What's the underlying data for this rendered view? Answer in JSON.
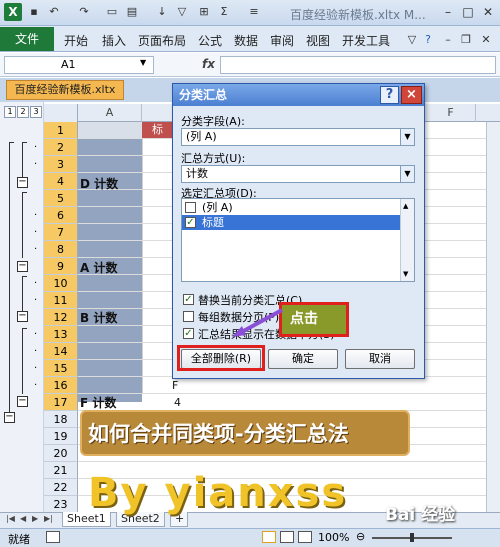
{
  "window": {
    "title": "百度经验新模板.xltx M..."
  },
  "ribbon": {
    "file": "文件",
    "tabs": [
      "开始",
      "插入",
      "页面布局",
      "公式",
      "数据",
      "审阅",
      "视图",
      "开发工具"
    ]
  },
  "formula_bar": {
    "name_box": "A1",
    "fx": "fx",
    "content": ""
  },
  "workbook_tab": "百度经验新模板.xltx",
  "outline_levels": [
    "1",
    "2",
    "3"
  ],
  "columns": [
    "A",
    "F"
  ],
  "rows": [
    "1",
    "2",
    "3",
    "4",
    "5",
    "6",
    "7",
    "8",
    "9",
    "10",
    "11",
    "12",
    "13",
    "14",
    "15",
    "16",
    "17",
    "18",
    "19",
    "20",
    "21",
    "22",
    "23"
  ],
  "sheet": {
    "b1_header": "标",
    "groups": [
      {
        "label": "D 计数"
      },
      {
        "label": "A 计数"
      },
      {
        "label": "B 计数"
      },
      {
        "label": "F 计数",
        "value": "4"
      }
    ],
    "b16_value": "F"
  },
  "sheet_tabs": [
    "Sheet1",
    "Sheet2"
  ],
  "status": {
    "left": "就绪",
    "zoom": "100%"
  },
  "dialog": {
    "title": "分类汇总",
    "help": "?",
    "close": "×",
    "group_field_label": "分类字段(A):",
    "group_field_value": "(列 A)",
    "function_label": "汇总方式(U):",
    "function_value": "计数",
    "items_label": "选定汇总项(D):",
    "items": [
      {
        "label": "(列 A)",
        "checked": false
      },
      {
        "label": "标题",
        "checked": true
      }
    ],
    "options": [
      {
        "label": "替换当前分类汇总(C)",
        "checked": true
      },
      {
        "label": "每组数据分页(P)",
        "checked": false
      },
      {
        "label": "汇总结果显示在数据下方(S)",
        "checked": true
      }
    ],
    "buttons": {
      "remove_all": "全部删除(R)",
      "ok": "确定",
      "cancel": "取消"
    }
  },
  "annotations": {
    "click": "点击",
    "caption": "如何合并同类项-分类汇总法",
    "watermark": "By yianxss",
    "logo": "Bai 经验"
  },
  "colors": {
    "excel_green": "#1f7a3a",
    "highlight_red": "#e0201c",
    "selected_row": "#f6c964",
    "column_a_fill": "#93a4c0"
  }
}
